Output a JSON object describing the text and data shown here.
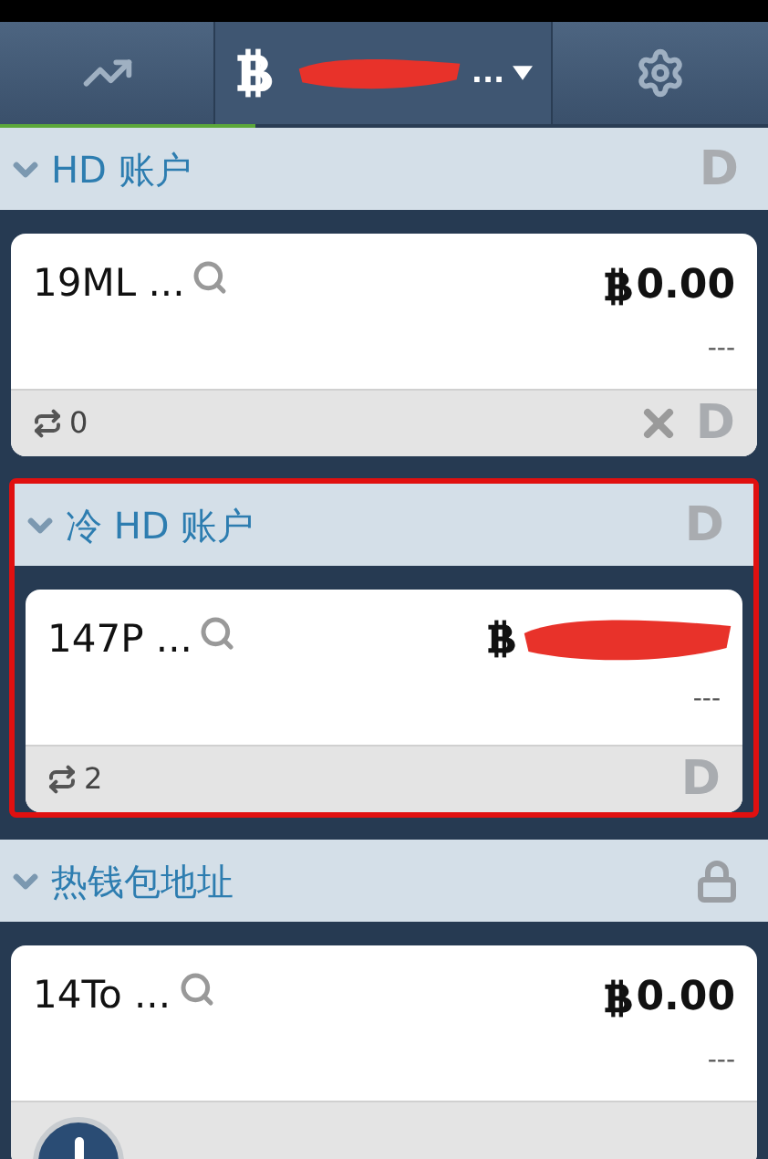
{
  "toolbar": {
    "tabs": [
      {
        "kind": "chart"
      },
      {
        "kind": "wallet",
        "name_redacted": true,
        "label": "..."
      },
      {
        "kind": "settings"
      }
    ]
  },
  "sections": [
    {
      "title": "HD 账户",
      "expanded": true,
      "highlighted": false,
      "indicator": {
        "kind": "letter",
        "label": "D"
      },
      "accounts": [
        {
          "address": "19ML ...",
          "balance": "0.00",
          "balance_redacted": false,
          "fiat": "---",
          "tx_count": "0",
          "actions": [
            {
              "kind": "x"
            },
            {
              "kind": "letter",
              "label": "D"
            }
          ]
        }
      ]
    },
    {
      "title": "冷 HD 账户",
      "expanded": true,
      "highlighted": true,
      "indicator": {
        "kind": "letter",
        "label": "D"
      },
      "accounts": [
        {
          "address": "147P ...",
          "balance_redacted": true,
          "fiat": "---",
          "tx_count": "2",
          "actions": [
            {
              "kind": "letter",
              "label": "D"
            }
          ]
        }
      ]
    },
    {
      "title": "热钱包地址",
      "expanded": true,
      "highlighted": false,
      "indicator": {
        "kind": "lock"
      },
      "accounts": [
        {
          "address": "14To ...",
          "balance": "0.00",
          "balance_redacted": false,
          "fiat": "---"
        }
      ]
    }
  ]
}
